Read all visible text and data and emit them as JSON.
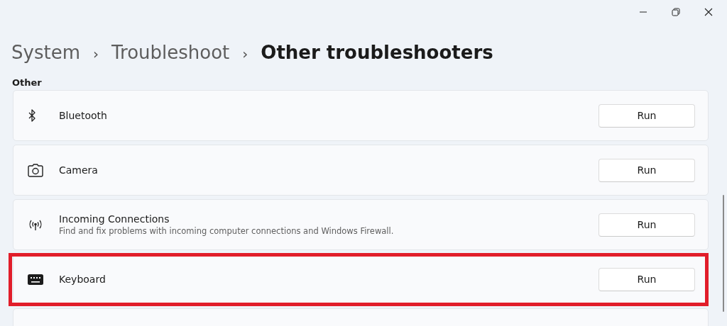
{
  "breadcrumb": [
    {
      "label": "System",
      "current": false
    },
    {
      "label": "Troubleshoot",
      "current": false
    },
    {
      "label": "Other troubleshooters",
      "current": true
    }
  ],
  "breadcrumb_separator": "›",
  "section_title": "Other",
  "items": [
    {
      "kind": "bluetooth",
      "label": "Bluetooth",
      "button": "Run",
      "highlighted": false
    },
    {
      "kind": "camera",
      "label": "Camera",
      "button": "Run",
      "highlighted": false
    },
    {
      "kind": "antenna",
      "label": "Incoming Connections",
      "description": "Find and fix problems with incoming computer connections and Windows Firewall.",
      "button": "Run",
      "highlighted": false
    },
    {
      "kind": "keyboard",
      "label": "Keyboard",
      "button": "Run",
      "highlighted": true
    }
  ]
}
